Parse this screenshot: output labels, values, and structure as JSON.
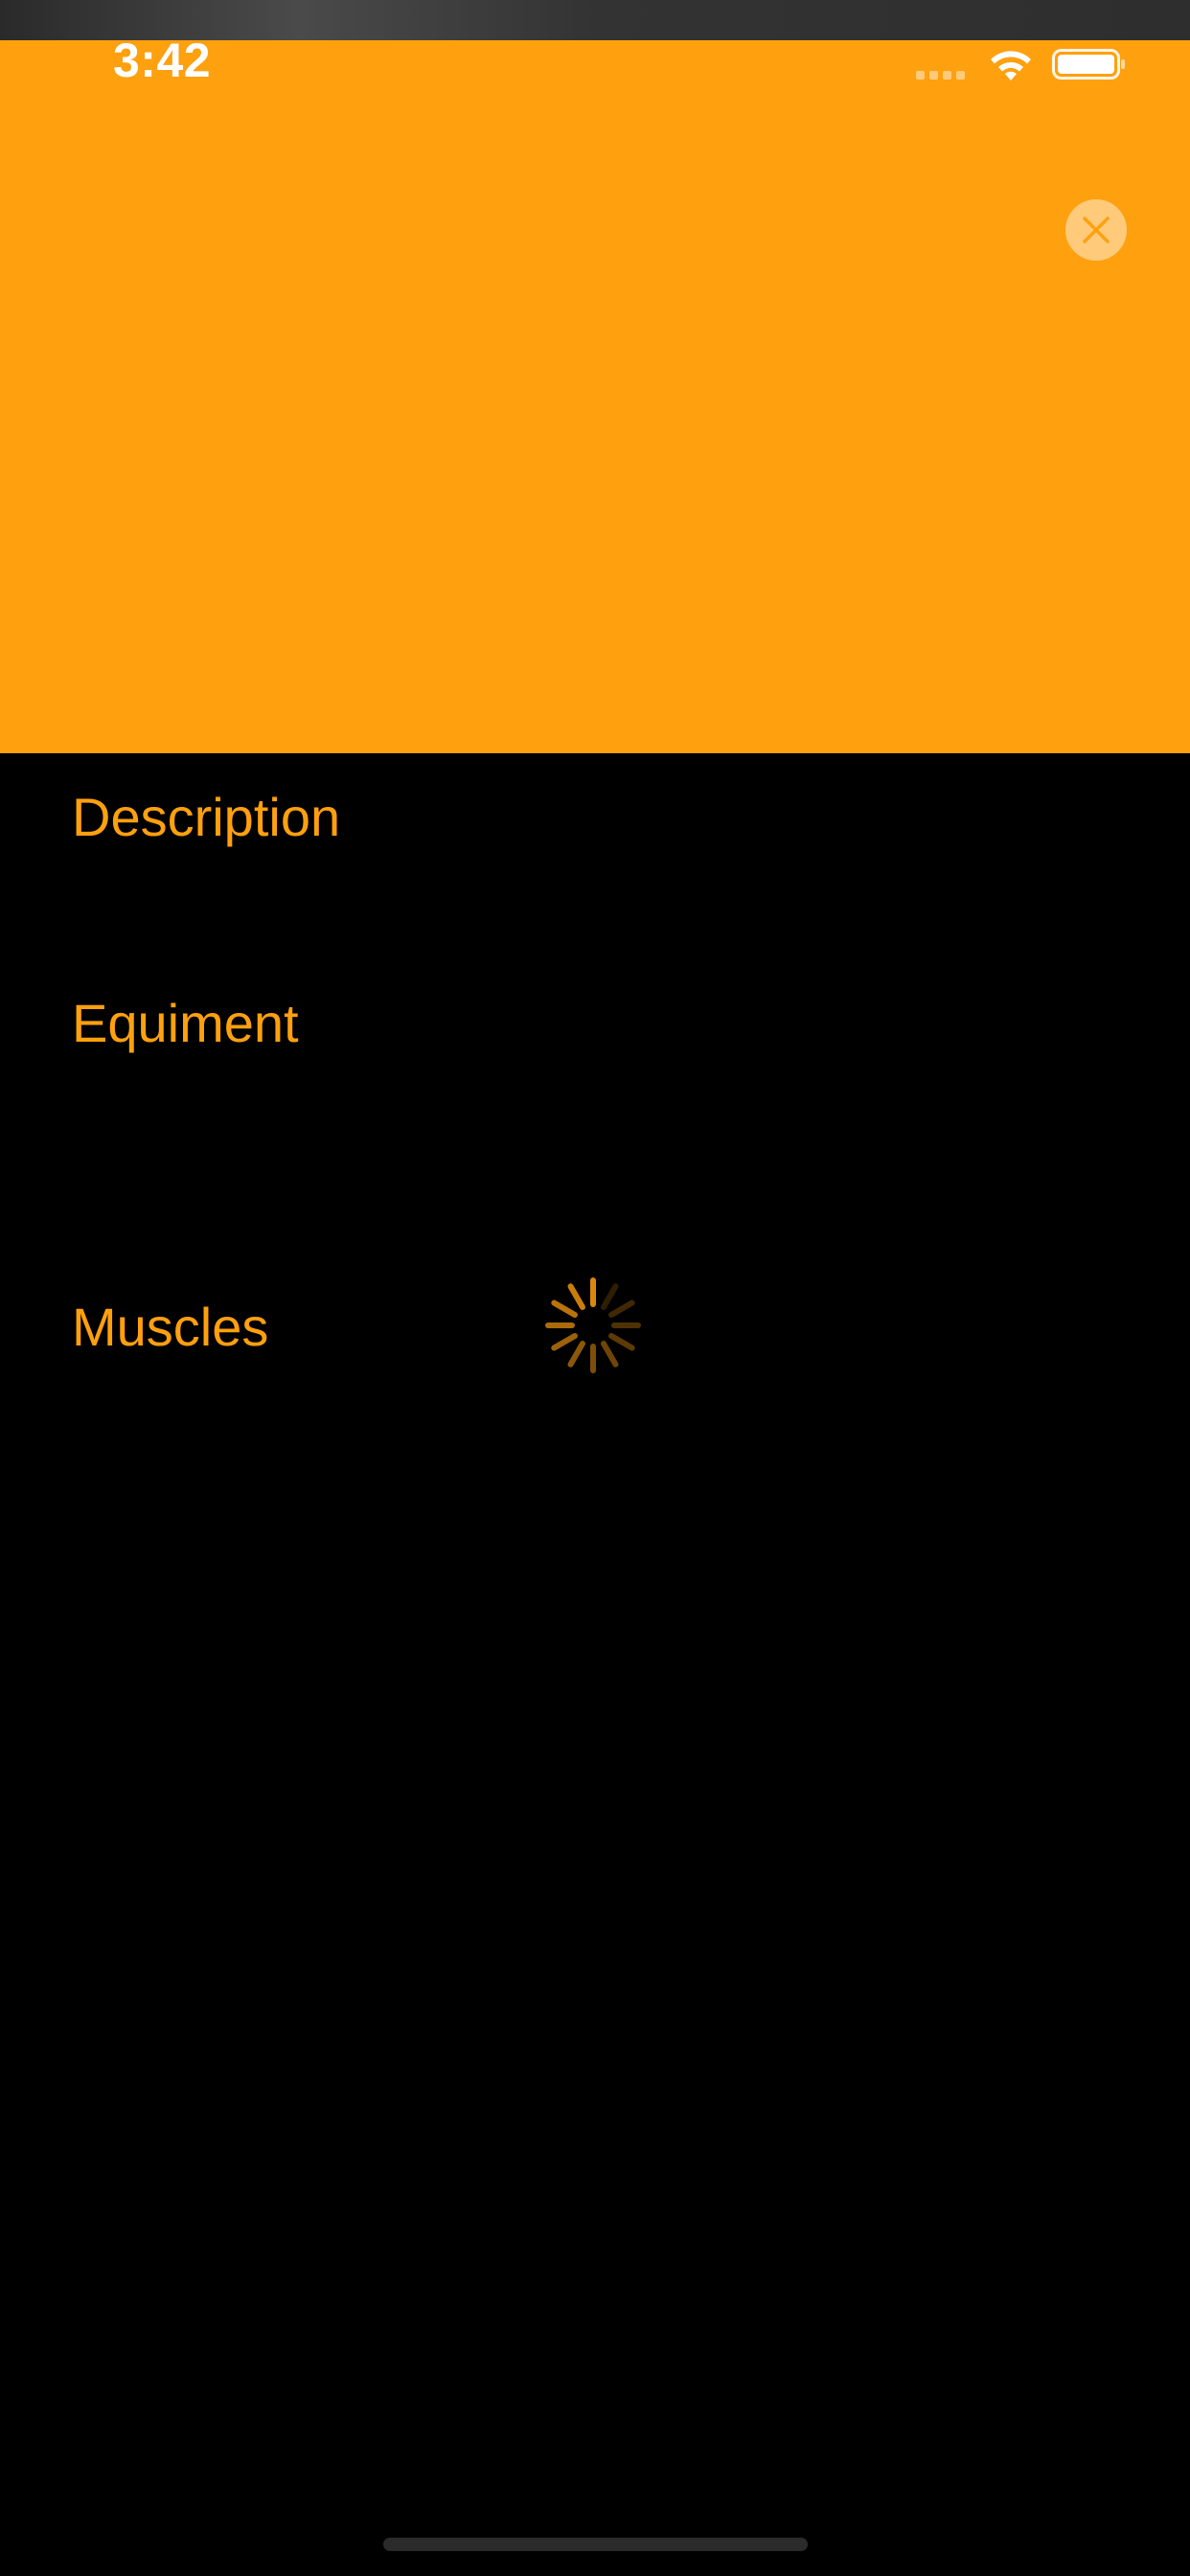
{
  "status_bar": {
    "time": "3:42"
  },
  "header": {
    "color": "#ffa00f",
    "close_icon": "close-icon"
  },
  "sections": {
    "description": "Description",
    "equipment": "Equiment",
    "muscles": "Muscles"
  },
  "loading": {
    "icon": "spinner-icon",
    "color": "#ffa00f"
  }
}
